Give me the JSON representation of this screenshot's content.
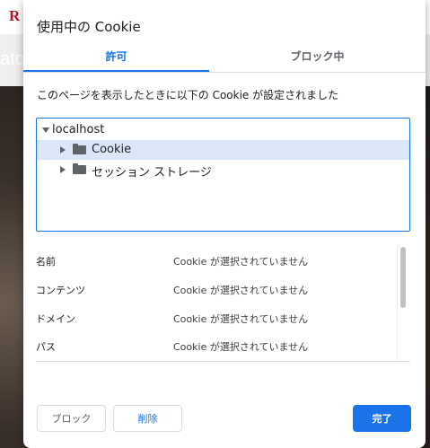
{
  "background": {
    "logo_text": "R",
    "partial_text": "atc"
  },
  "dialog": {
    "title": "使用中の Cookie",
    "tabs": [
      {
        "label": "許可"
      },
      {
        "label": "ブロック中"
      }
    ],
    "description": "このページを表示したときに以下の Cookie が設定されました",
    "tree": {
      "root": "localhost",
      "children": [
        {
          "label": "Cookie"
        },
        {
          "label": "セッション ストレージ"
        }
      ]
    },
    "details": [
      {
        "label": "名前",
        "value": "Cookie が選択されていません"
      },
      {
        "label": "コンテンツ",
        "value": "Cookie が選択されていません"
      },
      {
        "label": "ドメイン",
        "value": "Cookie が選択されていません"
      },
      {
        "label": "パス",
        "value": "Cookie が選択されていません"
      }
    ],
    "buttons": {
      "block": "ブロック",
      "delete": "削除",
      "done": "完了"
    }
  },
  "colors": {
    "accent": "#1a73e8",
    "selected_row": "#dbe7f9"
  }
}
